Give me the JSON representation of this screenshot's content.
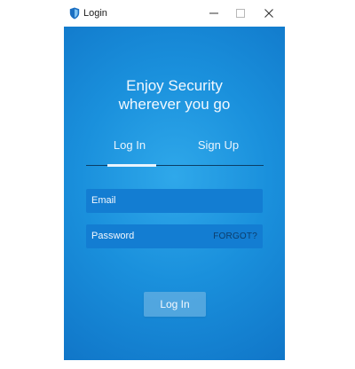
{
  "window": {
    "title": "Login"
  },
  "header": {
    "line1": "Enjoy Security",
    "line2": "wherever you go"
  },
  "tabs": [
    {
      "label": "Log In",
      "active": true
    },
    {
      "label": "Sign Up",
      "active": false
    }
  ],
  "form": {
    "email_label": "Email",
    "password_label": "Password",
    "forgot_label": "FORGOT?"
  },
  "actions": {
    "login_label": "Log In"
  },
  "colors": {
    "accent": "#1a90dc",
    "field_bg": "#137dd2",
    "forgot": "#0c3d6b"
  },
  "icons": {
    "app": "shield-icon",
    "minimize": "minimize-icon",
    "maximize": "maximize-icon",
    "close": "close-icon"
  }
}
